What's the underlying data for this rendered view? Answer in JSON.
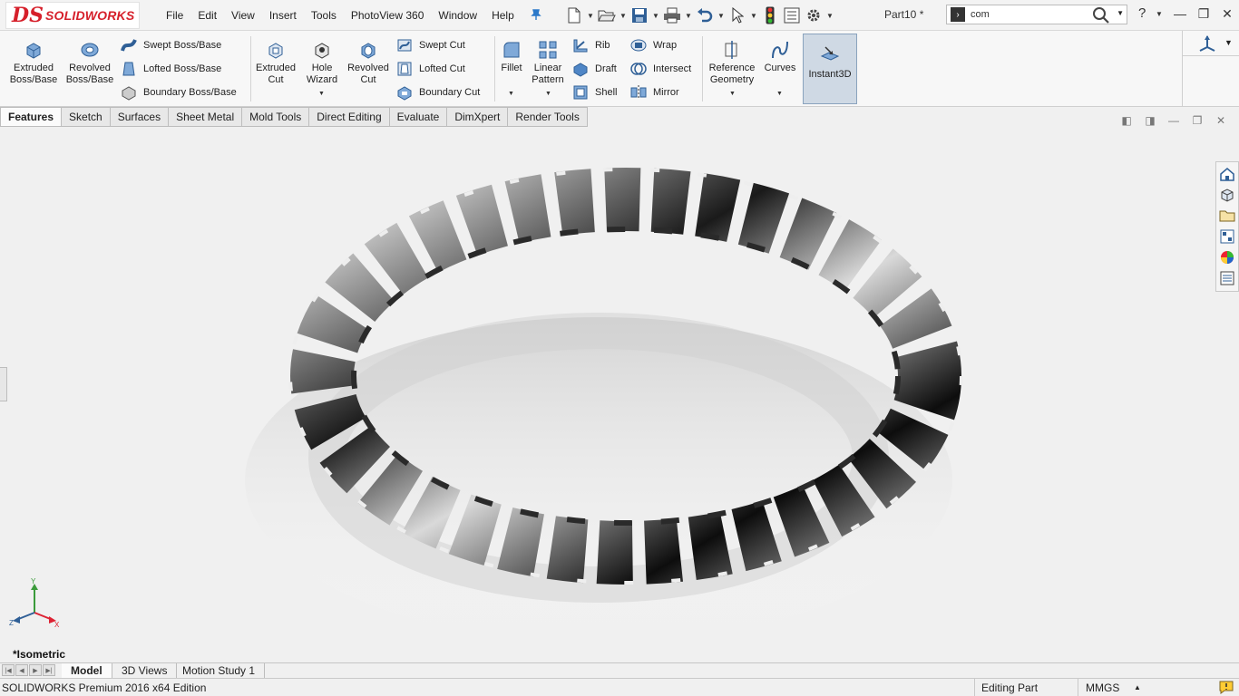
{
  "app": {
    "logo_ds": "DS",
    "logo_text": "SOLIDWORKS",
    "document_title": "Part10 *"
  },
  "menu": [
    "File",
    "Edit",
    "View",
    "Insert",
    "Tools",
    "PhotoView 360",
    "Window",
    "Help"
  ],
  "search": {
    "value": "com"
  },
  "help_label": "?",
  "commands": {
    "extruded_boss": "Extruded Boss/Base",
    "revolved_boss": "Revolved Boss/Base",
    "swept_boss": "Swept Boss/Base",
    "lofted_boss": "Lofted Boss/Base",
    "boundary_boss": "Boundary Boss/Base",
    "extruded_cut": "Extruded Cut",
    "hole_wizard": "Hole Wizard",
    "revolved_cut": "Revolved Cut",
    "swept_cut": "Swept Cut",
    "lofted_cut": "Lofted Cut",
    "boundary_cut": "Boundary Cut",
    "fillet": "Fillet",
    "linear_pattern": "Linear Pattern",
    "rib": "Rib",
    "draft": "Draft",
    "shell": "Shell",
    "wrap": "Wrap",
    "intersect": "Intersect",
    "mirror": "Mirror",
    "reference_geometry": "Reference Geometry",
    "curves": "Curves",
    "instant3d": "Instant3D"
  },
  "tabs": [
    "Features",
    "Sketch",
    "Surfaces",
    "Sheet Metal",
    "Mold Tools",
    "Direct Editing",
    "Evaluate",
    "DimXpert",
    "Render Tools"
  ],
  "active_tab": "Features",
  "viewport": {
    "view_label": "*Isometric",
    "triad": {
      "x": "X",
      "y": "Y",
      "z": "Z"
    }
  },
  "bottom_tabs": [
    "Model",
    "3D Views",
    "Motion Study 1"
  ],
  "status": {
    "product": "SOLIDWORKS Premium 2016 x64 Edition",
    "mode": "Editing Part",
    "units": "MMGS"
  },
  "colors": {
    "brand_red": "#d6202b",
    "accent_blue": "#2b79c9",
    "instant3d_active": "#cfd9e4"
  }
}
